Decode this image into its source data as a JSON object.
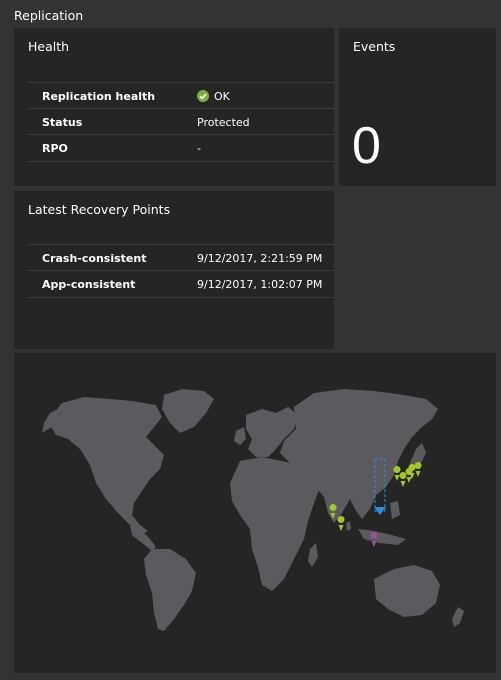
{
  "section": {
    "title": "Replication"
  },
  "health": {
    "title": "Health",
    "rows": [
      {
        "label": "Replication health",
        "value": "OK",
        "icon": "check-circle-icon"
      },
      {
        "label": "Status",
        "value": "Protected"
      },
      {
        "label": "RPO",
        "value": "-"
      }
    ]
  },
  "events": {
    "title": "Events",
    "count": "0"
  },
  "recovery": {
    "title": "Latest Recovery Points",
    "rows": [
      {
        "label": "Crash-consistent",
        "value": "9/12/2017, 2:21:59 PM"
      },
      {
        "label": "App-consistent",
        "value": "9/12/2017, 1:02:07 PM"
      }
    ]
  },
  "colors": {
    "background": "#333333",
    "tile": "#252526",
    "map_land": "#5b5b5f",
    "ok_green": "#7ab03b",
    "pin_green": "#a2c62a",
    "pin_purple": "#9b4f9b",
    "arrow_blue": "#2f8ee0"
  },
  "map": {
    "pins": [
      {
        "name": "pin-india-north",
        "color": "green"
      },
      {
        "name": "pin-india-south",
        "color": "green"
      },
      {
        "name": "pin-east-asia-1",
        "color": "green"
      },
      {
        "name": "pin-east-asia-2",
        "color": "green"
      },
      {
        "name": "pin-east-asia-3",
        "color": "green"
      },
      {
        "name": "pin-japan-1",
        "color": "green"
      },
      {
        "name": "pin-japan-2",
        "color": "green"
      },
      {
        "name": "pin-southeast-asia",
        "color": "purple"
      }
    ]
  }
}
